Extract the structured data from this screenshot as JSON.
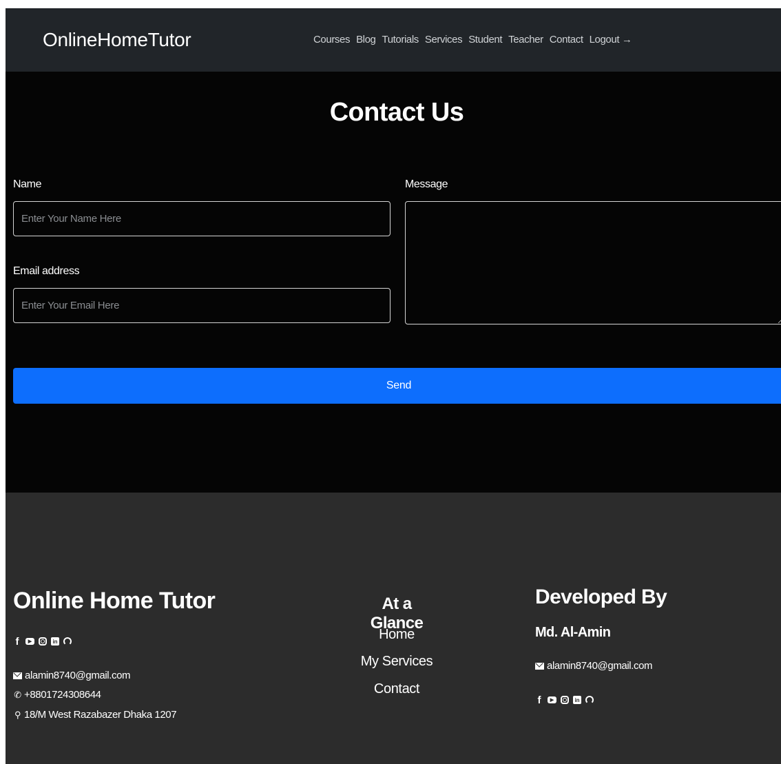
{
  "navbar": {
    "brand": "OnlineHomeTutor",
    "links": [
      "Courses",
      "Blog",
      "Tutorials",
      "Services",
      "Student",
      "Teacher",
      "Contact",
      "Logout →"
    ]
  },
  "contact": {
    "title": "Contact Us",
    "name_label": "Name",
    "name_placeholder": "Enter Your Name Here",
    "email_label": "Email address",
    "email_placeholder": "Enter Your Email Here",
    "message_label": "Message",
    "send_label": "Send"
  },
  "footer": {
    "brand_title": "Online Home Tutor",
    "email": "alamin8740@gmail.com",
    "phone": "+8801724308644",
    "address": "18/M West Razabazer Dhaka 1207",
    "glance_title": "At a Glance",
    "glance_links": [
      "Home",
      "My Services",
      "Contact"
    ],
    "dev_title": "Developed By",
    "dev_name": "Md. Al-Amin",
    "dev_email": "alamin8740@gmail.com",
    "social_icons": [
      "facebook-icon",
      "youtube-icon",
      "instagram-icon",
      "linkedin-icon",
      "github-icon"
    ]
  },
  "colors": {
    "navbar_bg": "#212529",
    "main_bg": "#050505",
    "footer_bg": "#2c2c2c",
    "primary": "#0d6efd"
  }
}
